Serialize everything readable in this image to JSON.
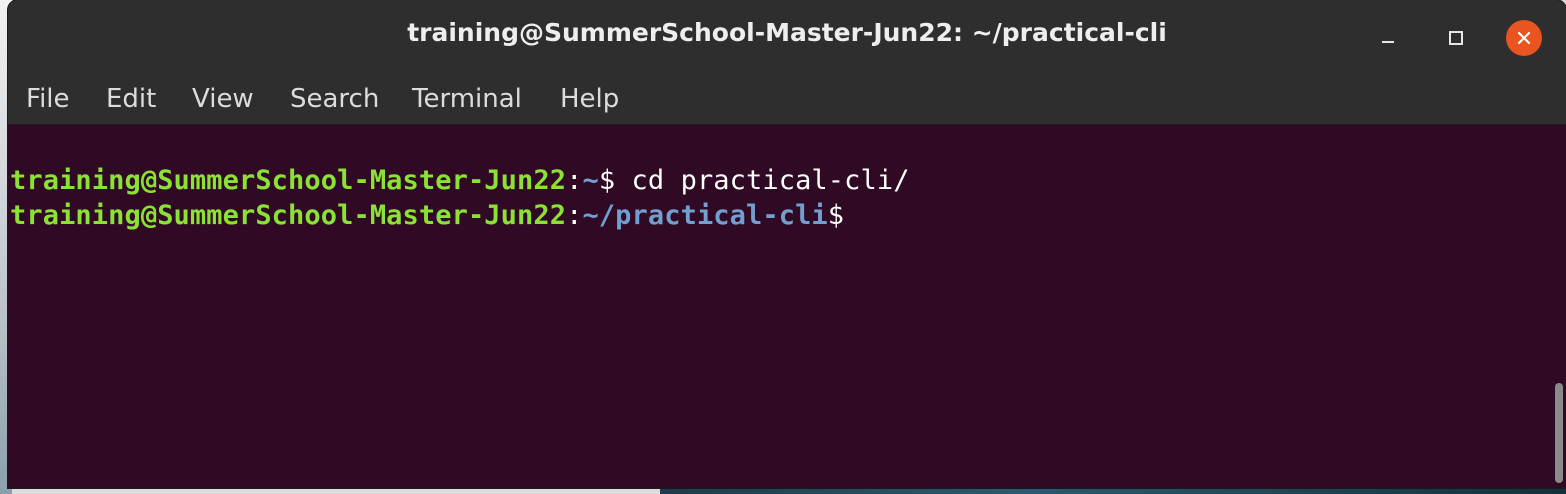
{
  "window": {
    "title": "training@SummerSchool-Master-Jun22: ~/practical-cli",
    "controls": {
      "minimize_icon": "minimize-icon",
      "maximize_icon": "maximize-icon",
      "close_icon": "close-icon",
      "close_color": "#e95420"
    }
  },
  "menubar": {
    "items": [
      "File",
      "Edit",
      "View",
      "Search",
      "Terminal",
      "Help"
    ]
  },
  "terminal": {
    "background": "#300a24",
    "user_color": "#8ae234",
    "path_color": "#729fcf",
    "lines": [
      {
        "user_host": "training@SummerSchool-Master-Jun22",
        "colon": ":",
        "path": "~",
        "prompt": "$",
        "command": " cd practical-cli/"
      },
      {
        "user_host": "training@SummerSchool-Master-Jun22",
        "colon": ":",
        "path": "~/practical-cli",
        "prompt": "$",
        "command": ""
      }
    ]
  }
}
